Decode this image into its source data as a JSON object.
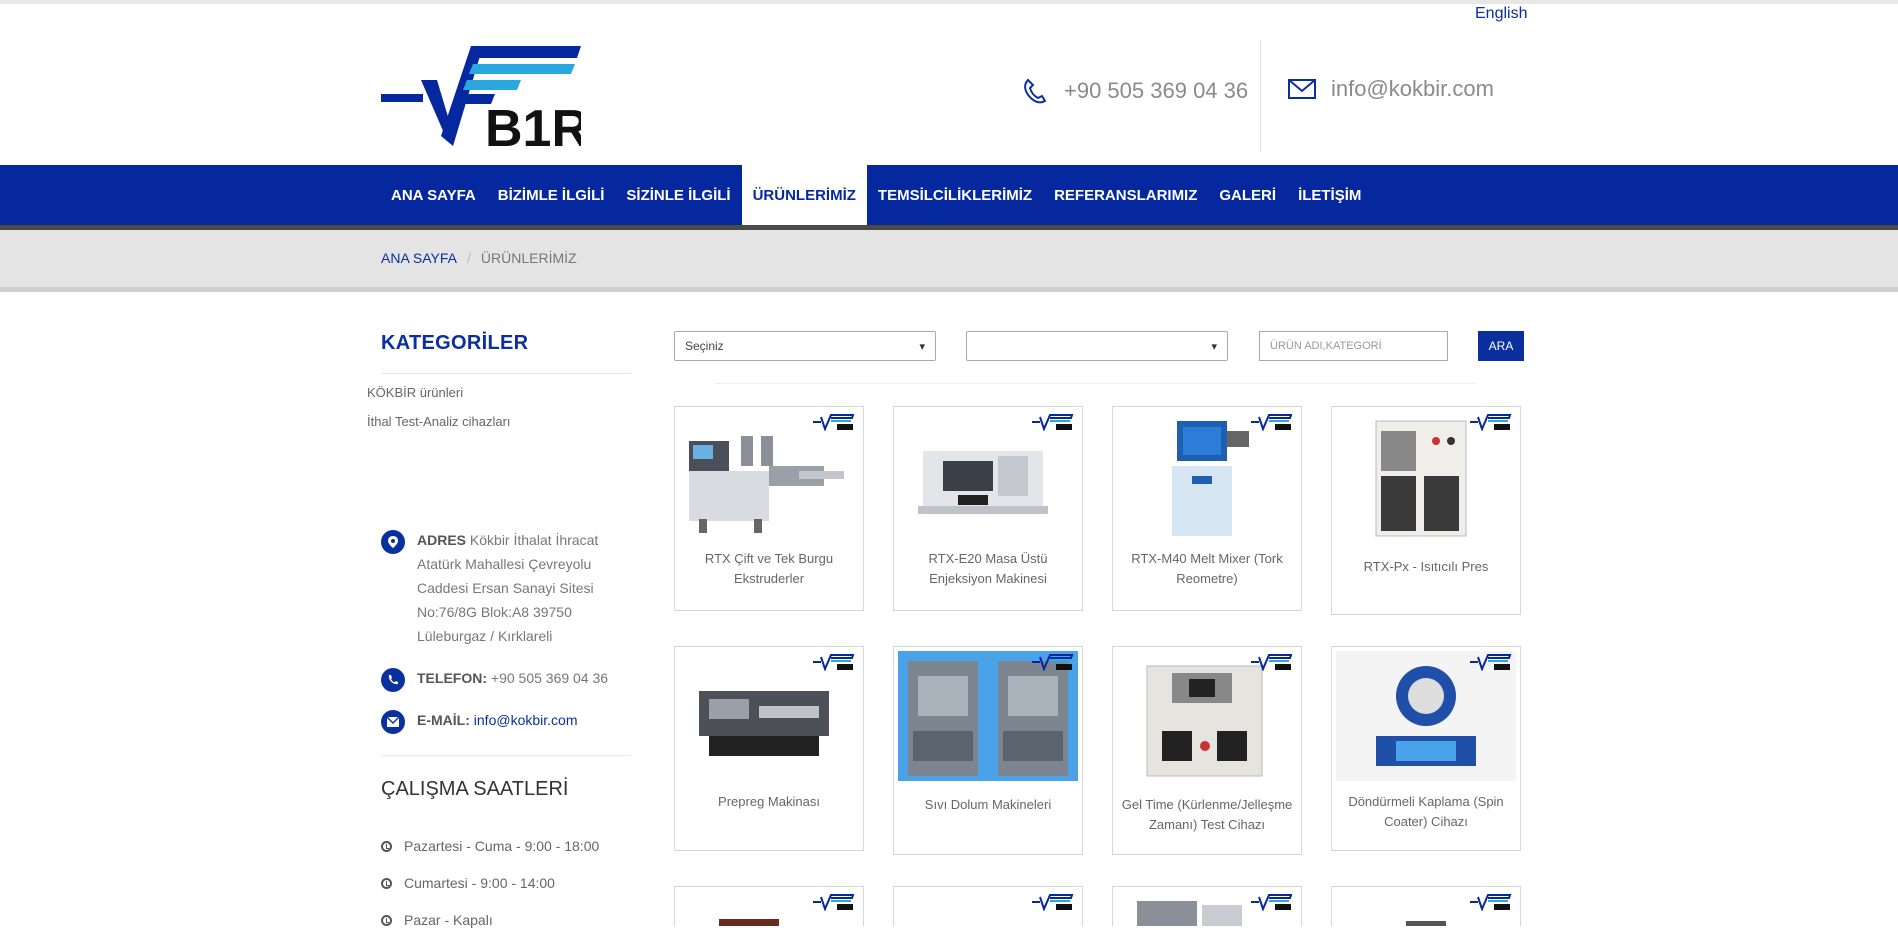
{
  "header": {
    "language_link": "English",
    "logo_text": "B1R",
    "phone": "+90 505 369 04 36",
    "email": "info@kokbir.com"
  },
  "nav": {
    "items": [
      {
        "label": "ANA SAYFA"
      },
      {
        "label": "BİZİMLE İLGİLİ"
      },
      {
        "label": "SİZİNLE İLGİLİ"
      },
      {
        "label": "ÜRÜNLERİMİZ"
      },
      {
        "label": "TEMSİLCİLİKLERİMİZ"
      },
      {
        "label": "REFERANSLARIMIZ"
      },
      {
        "label": "GALERİ"
      },
      {
        "label": "İLETİŞİM"
      }
    ],
    "active_index": 3
  },
  "breadcrumb": {
    "home": "ANA SAYFA",
    "separator": "/",
    "current": "ÜRÜNLERİMİZ"
  },
  "sidebar": {
    "title": "KATEGORİLER",
    "categories": [
      {
        "label": "KÖKBİR ürünleri"
      },
      {
        "label": "İthal Test-Analiz cihazları"
      }
    ],
    "address_label": "ADRES",
    "address_lines": [
      "Kökbir İthalat İhracat",
      "Atatürk Mahallesi Çevreyolu",
      "Caddesi Ersan Sanayi Sitesi",
      "No:76/8G Blok:A8 39750",
      "Lüleburgaz / Kırklareli"
    ],
    "phone_label": "TELEFON:",
    "phone_value": "+90 505 369 04 36",
    "email_label": "E-MAİL:",
    "email_value": "info@kokbir.com",
    "hours_title": "ÇALIŞMA SAATLERİ",
    "hours": [
      {
        "text": "Pazartesi - Cuma - 9:00 - 18:00"
      },
      {
        "text": "Cumartesi - 9:00 - 14:00"
      },
      {
        "text": "Pazar - Kapalı"
      }
    ]
  },
  "filters": {
    "category_select": "Seçiniz",
    "subcategory_select": "",
    "search_placeholder": "ÜRÜN ADI,KATEGORİ",
    "search_button": "ARA"
  },
  "products": [
    {
      "title": "RTX Çift ve Tek Burgu Ekstruderler"
    },
    {
      "title": "RTX-E20 Masa Üstü Enjeksiyon Makinesi"
    },
    {
      "title": "RTX-M40 Melt Mixer (Tork Reometre)"
    },
    {
      "title": "RTX-Px - Isıtıcılı Pres"
    },
    {
      "title": "Prepreg Makinası"
    },
    {
      "title": "Sıvı Dolum Makineleri"
    },
    {
      "title": "Gel Time (Kürlenme/Jelleşme Zamanı) Test Cihazı"
    },
    {
      "title": "Döndürmeli Kaplama (Spin Coater) Cihazı"
    }
  ],
  "colors": {
    "brand_blue": "#06289e",
    "light_blue": "#29a8e0"
  }
}
